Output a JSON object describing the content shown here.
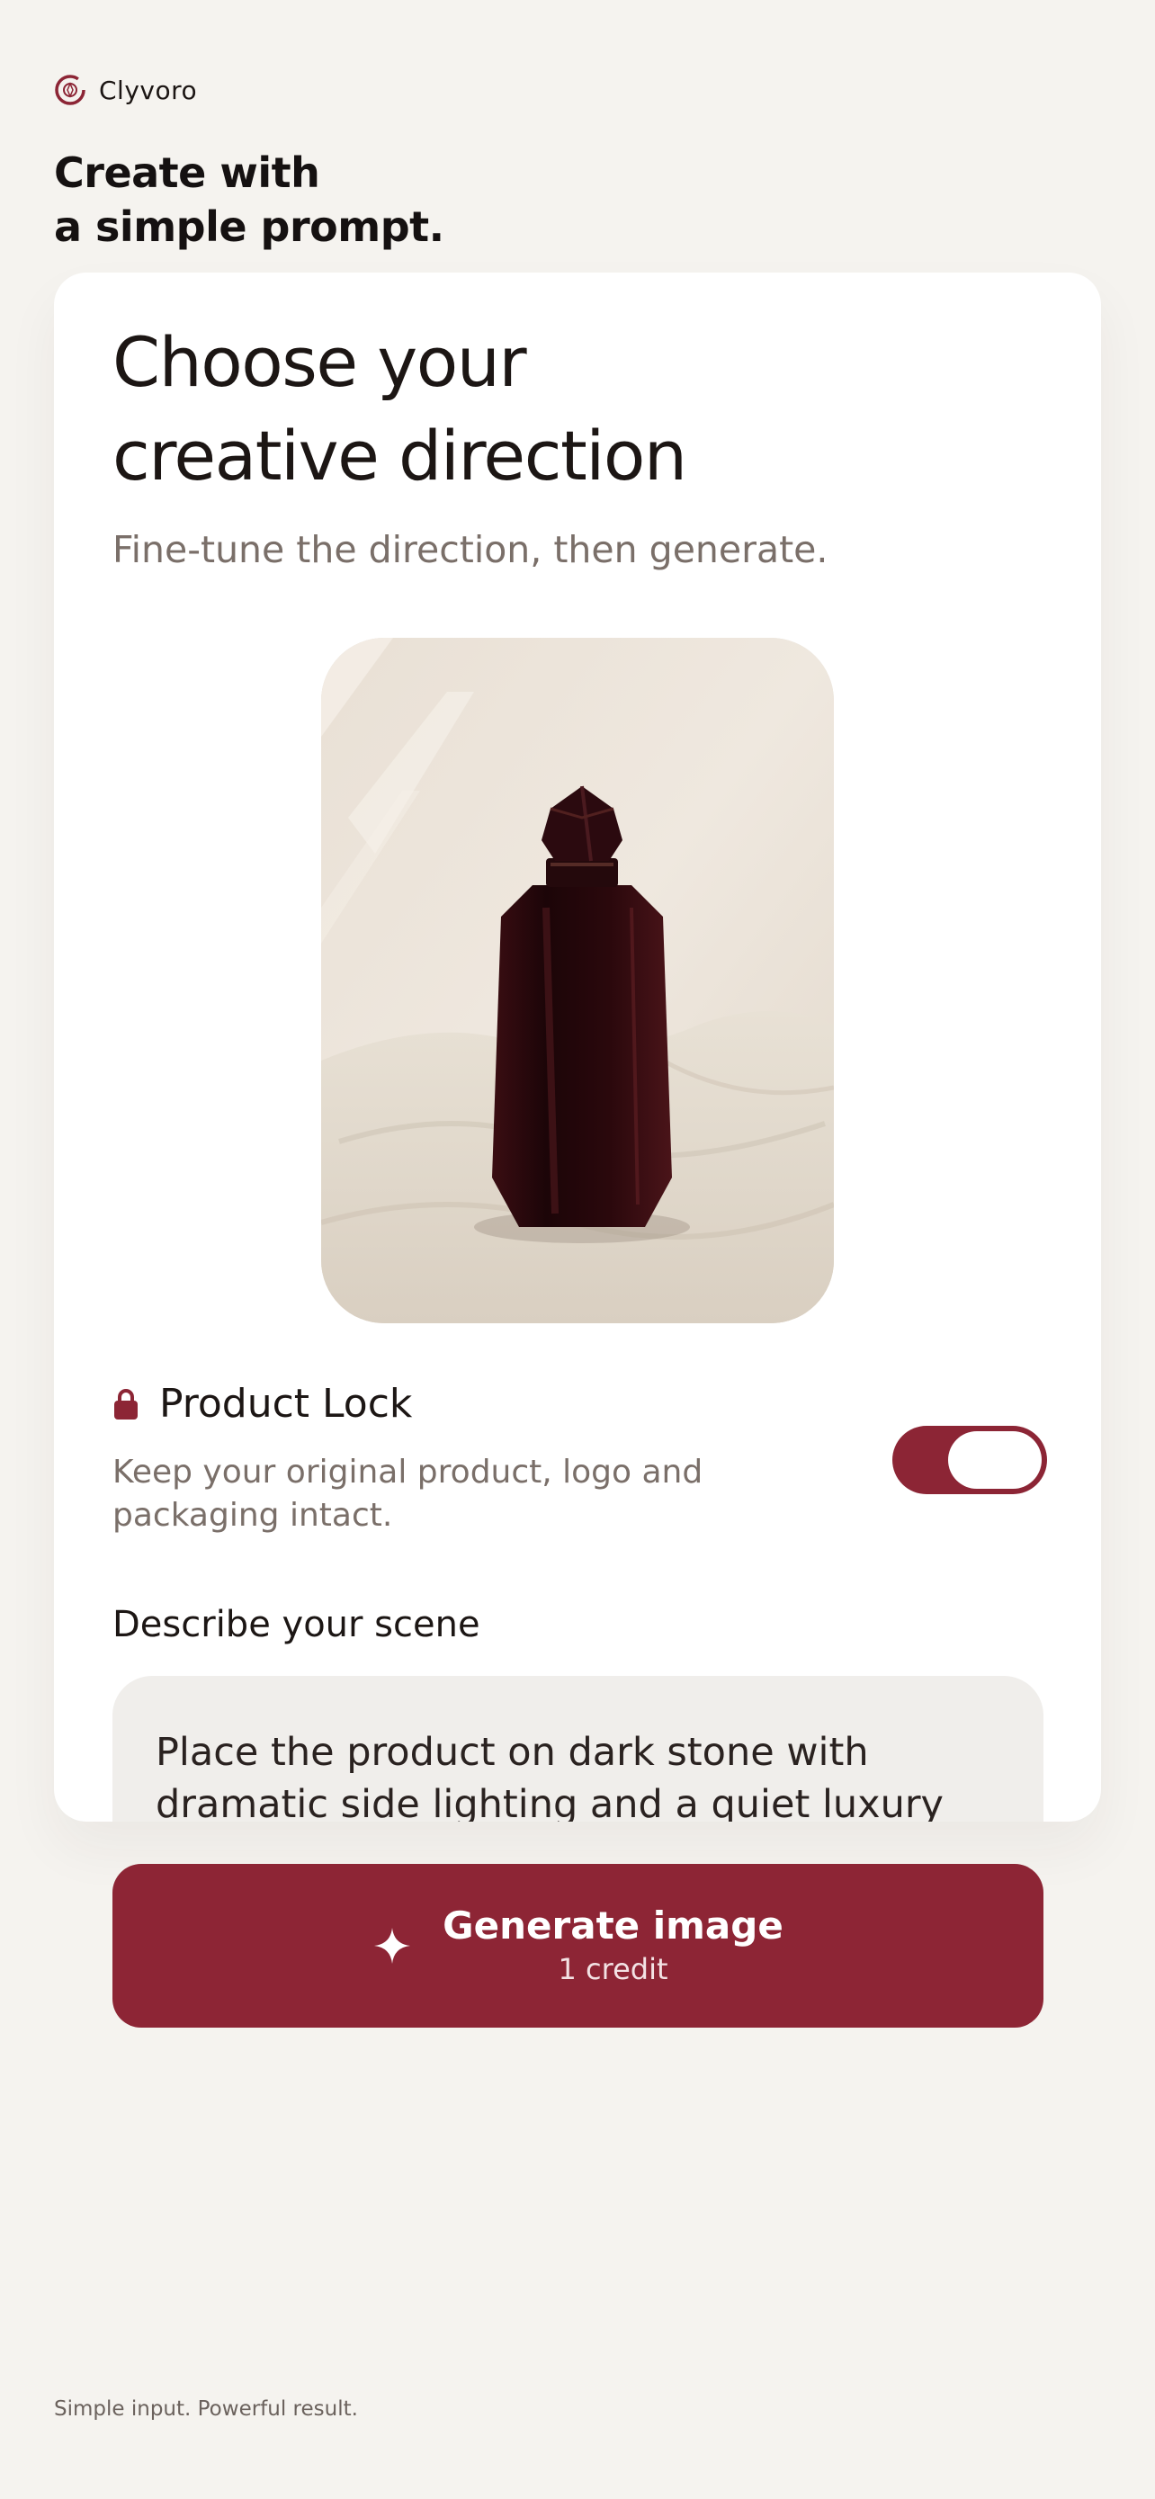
{
  "brand": {
    "name": "Clyvoro",
    "icon": "spiral-logo-icon",
    "accent": "#8c2535"
  },
  "tagline": {
    "line1": "Create with",
    "line2": "a simple prompt."
  },
  "card": {
    "title_line1": "Choose your",
    "title_line2": "creative direction",
    "subtitle": "Fine-tune the direction, then generate."
  },
  "product_image": {
    "subject": "perfume-bottle-image"
  },
  "product_lock": {
    "title": "Product Lock",
    "icon": "lock-icon",
    "description": "Keep your original product, logo and packaging intact.",
    "enabled": true
  },
  "scene": {
    "label": "Describe your scene",
    "value": "Place the product on dark stone with dramatic side lighting and a quiet luxury"
  },
  "generate": {
    "label": "Generate image",
    "credit": "1 credit",
    "icon": "sparkle-icon",
    "color": "#8d2535"
  },
  "footer": {
    "note": "Simple input. Powerful result."
  }
}
